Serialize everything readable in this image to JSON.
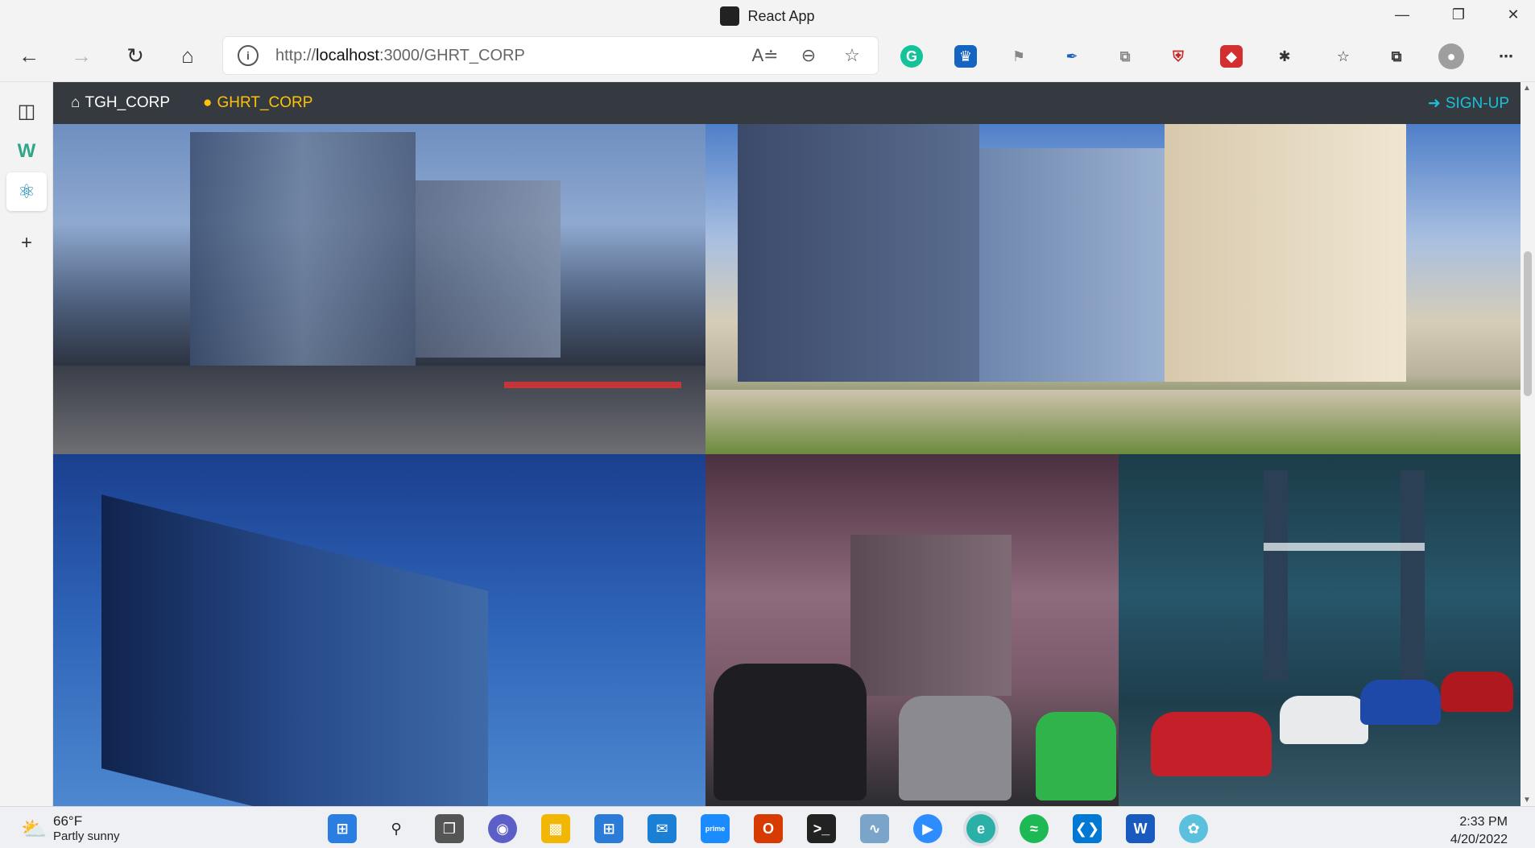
{
  "window": {
    "title": "React App"
  },
  "toolbar": {
    "url_prefix": "http://",
    "url_host": "localhost",
    "url_rest": ":3000/GHRT_CORP"
  },
  "navbar": {
    "home_label": "TGH_CORP",
    "ghrt_label": "GHRT_CORP",
    "signup_label": "SIGN-UP",
    "colors": {
      "background": "#343a40",
      "active": "#ffc107",
      "signup": "#17c2d8"
    }
  },
  "gallery": {
    "tiles": [
      {
        "name": "office-building-street-night"
      },
      {
        "name": "office-complex-plaza"
      },
      {
        "name": "glass-skyscraper-blue-sky"
      },
      {
        "name": "muscle-cars-in-rain"
      },
      {
        "name": "cars-near-tower-bridge"
      }
    ]
  },
  "taskbar": {
    "weather_temp": "66°F",
    "weather_desc": "Partly sunny",
    "time": "2:33 PM",
    "date": "4/20/2022",
    "apps": [
      "start",
      "search",
      "task-view",
      "teams-chat",
      "file-explorer",
      "microsoft-store",
      "mail",
      "prime-video",
      "office",
      "terminal",
      "performance-monitor",
      "zoom",
      "edge",
      "spotify",
      "vscode",
      "word",
      "paint"
    ]
  }
}
